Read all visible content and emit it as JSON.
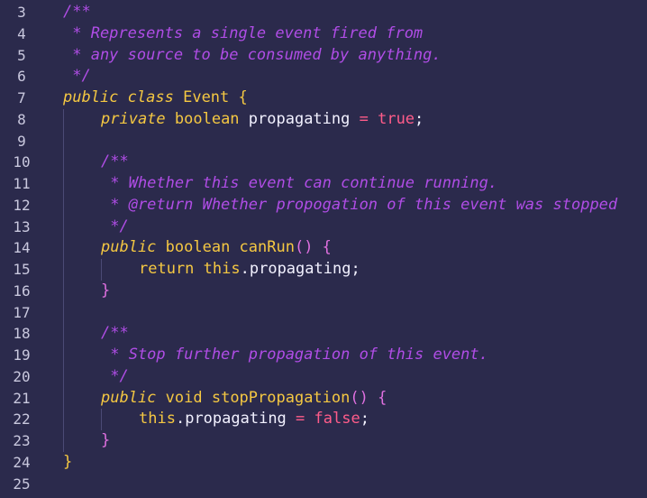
{
  "editor": {
    "language": "java",
    "colors": {
      "background": "#2b2a4c",
      "keyword": "#f5c842",
      "comment": "#b04de6",
      "operator": "#ff5c8a",
      "identifier": "#f2f1ff",
      "line_number": "#c9c8de"
    },
    "line_numbers": [
      "3",
      "4",
      "5",
      "6",
      "7",
      "8",
      "9",
      "10",
      "11",
      "12",
      "13",
      "14",
      "15",
      "16",
      "17",
      "18",
      "19",
      "20",
      "21",
      "22",
      "23",
      "24",
      "25"
    ],
    "lines": [
      {
        "indent": 0,
        "tokens": [
          {
            "t": "/**",
            "c": "cmt"
          }
        ]
      },
      {
        "indent": 0,
        "tokens": [
          {
            "t": " * Represents a single event fired from",
            "c": "cmt"
          }
        ]
      },
      {
        "indent": 0,
        "tokens": [
          {
            "t": " * any source to be consumed by anything.",
            "c": "cmt"
          }
        ]
      },
      {
        "indent": 0,
        "tokens": [
          {
            "t": " */",
            "c": "cmt"
          }
        ]
      },
      {
        "indent": 0,
        "tokens": [
          {
            "t": "public",
            "c": "kw"
          },
          {
            "t": " ",
            "c": "plain"
          },
          {
            "t": "class",
            "c": "kw"
          },
          {
            "t": " Event {",
            "c": "cls"
          }
        ]
      },
      {
        "indent": 1,
        "tokens": [
          {
            "t": "private",
            "c": "kw"
          },
          {
            "t": " boolean ",
            "c": "type"
          },
          {
            "t": "propagating",
            "c": "ident"
          },
          {
            "t": " = ",
            "c": "op"
          },
          {
            "t": "true",
            "c": "bool"
          },
          {
            "t": ";",
            "c": "plain"
          }
        ]
      },
      {
        "indent": 1,
        "tokens": []
      },
      {
        "indent": 1,
        "tokens": [
          {
            "t": "/**",
            "c": "cmt"
          }
        ]
      },
      {
        "indent": 1,
        "tokens": [
          {
            "t": " * Whether this event can continue running.",
            "c": "cmt"
          }
        ]
      },
      {
        "indent": 1,
        "tokens": [
          {
            "t": " * @return Whether propogation of this event was stopped",
            "c": "cmt"
          }
        ]
      },
      {
        "indent": 1,
        "tokens": [
          {
            "t": " */",
            "c": "cmt"
          }
        ]
      },
      {
        "indent": 1,
        "tokens": [
          {
            "t": "public",
            "c": "kw"
          },
          {
            "t": " boolean ",
            "c": "type"
          },
          {
            "t": "canRun",
            "c": "fn"
          },
          {
            "t": "() {",
            "c": "brace-p"
          }
        ]
      },
      {
        "indent": 2,
        "tokens": [
          {
            "t": "return",
            "c": "type"
          },
          {
            "t": " this",
            "c": "type"
          },
          {
            "t": ".",
            "c": "plain"
          },
          {
            "t": "propagating",
            "c": "ident"
          },
          {
            "t": ";",
            "c": "plain"
          }
        ]
      },
      {
        "indent": 1,
        "tokens": [
          {
            "t": "}",
            "c": "brace-p"
          }
        ]
      },
      {
        "indent": 1,
        "tokens": []
      },
      {
        "indent": 1,
        "tokens": [
          {
            "t": "/**",
            "c": "cmt"
          }
        ]
      },
      {
        "indent": 1,
        "tokens": [
          {
            "t": " * Stop further propagation of this event.",
            "c": "cmt"
          }
        ]
      },
      {
        "indent": 1,
        "tokens": [
          {
            "t": " */",
            "c": "cmt"
          }
        ]
      },
      {
        "indent": 1,
        "tokens": [
          {
            "t": "public",
            "c": "kw"
          },
          {
            "t": " void ",
            "c": "type"
          },
          {
            "t": "stopPropagation",
            "c": "fn"
          },
          {
            "t": "() {",
            "c": "brace-p"
          }
        ]
      },
      {
        "indent": 2,
        "tokens": [
          {
            "t": "this",
            "c": "type"
          },
          {
            "t": ".",
            "c": "plain"
          },
          {
            "t": "propagating",
            "c": "ident"
          },
          {
            "t": " = ",
            "c": "op"
          },
          {
            "t": "false",
            "c": "bool"
          },
          {
            "t": ";",
            "c": "plain"
          }
        ]
      },
      {
        "indent": 1,
        "tokens": [
          {
            "t": "}",
            "c": "brace-p"
          }
        ]
      },
      {
        "indent": 0,
        "tokens": [
          {
            "t": "}",
            "c": "cls"
          }
        ]
      },
      {
        "indent": 0,
        "tokens": []
      }
    ]
  }
}
